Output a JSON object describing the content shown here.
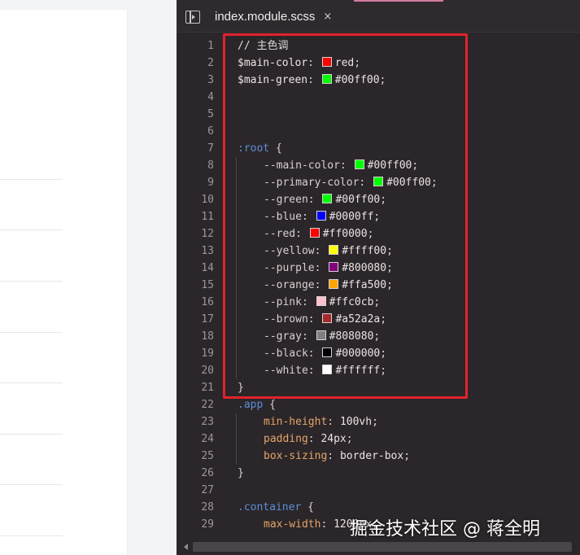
{
  "editor": {
    "tab": {
      "filename": "index.module.scss",
      "close_symbol": "×"
    },
    "colors": {
      "background": "#2b2629",
      "selector": "#5c8fd8",
      "property": "#e4a56a",
      "highlight_box": "#e0232d",
      "tab_accent": "#d57aa3"
    },
    "lines": [
      {
        "num": "1",
        "tokens": [
          {
            "t": "// 主色调",
            "c": "comment"
          }
        ]
      },
      {
        "num": "2",
        "tokens": [
          {
            "t": "$main-color",
            "c": "var"
          },
          {
            "t": ": ",
            "c": "punc"
          },
          {
            "swatch": "#ff0000"
          },
          {
            "t": "red",
            "c": "val"
          },
          {
            "t": ";",
            "c": "punc"
          }
        ]
      },
      {
        "num": "3",
        "tokens": [
          {
            "t": "$main-green",
            "c": "var"
          },
          {
            "t": ": ",
            "c": "punc"
          },
          {
            "swatch": "#00ff00"
          },
          {
            "t": "#00ff00",
            "c": "val"
          },
          {
            "t": ";",
            "c": "punc"
          }
        ]
      },
      {
        "num": "4",
        "tokens": []
      },
      {
        "num": "5",
        "tokens": []
      },
      {
        "num": "6",
        "tokens": []
      },
      {
        "num": "7",
        "tokens": [
          {
            "t": ":root",
            "c": "sel"
          },
          {
            "t": " {",
            "c": "punc"
          }
        ]
      },
      {
        "num": "8",
        "indent": 1,
        "tokens": [
          {
            "t": "--main-color",
            "c": "cprop"
          },
          {
            "t": ": ",
            "c": "punc"
          },
          {
            "swatch": "#00ff00"
          },
          {
            "t": "#00ff00",
            "c": "val"
          },
          {
            "t": ";",
            "c": "punc"
          }
        ]
      },
      {
        "num": "9",
        "indent": 1,
        "tokens": [
          {
            "t": "--primary-color",
            "c": "cprop"
          },
          {
            "t": ": ",
            "c": "punc"
          },
          {
            "swatch": "#00ff00"
          },
          {
            "t": "#00ff00",
            "c": "val"
          },
          {
            "t": ";",
            "c": "punc"
          }
        ]
      },
      {
        "num": "10",
        "indent": 1,
        "tokens": [
          {
            "t": "--green",
            "c": "cprop"
          },
          {
            "t": ": ",
            "c": "punc"
          },
          {
            "swatch": "#00ff00"
          },
          {
            "t": "#00ff00",
            "c": "val"
          },
          {
            "t": ";",
            "c": "punc"
          }
        ]
      },
      {
        "num": "11",
        "indent": 1,
        "tokens": [
          {
            "t": "--blue",
            "c": "cprop"
          },
          {
            "t": ": ",
            "c": "punc"
          },
          {
            "swatch": "#0000ff"
          },
          {
            "t": "#0000ff",
            "c": "val"
          },
          {
            "t": ";",
            "c": "punc"
          }
        ]
      },
      {
        "num": "12",
        "indent": 1,
        "tokens": [
          {
            "t": "--red",
            "c": "cprop"
          },
          {
            "t": ": ",
            "c": "punc"
          },
          {
            "swatch": "#ff0000"
          },
          {
            "t": "#ff0000",
            "c": "val"
          },
          {
            "t": ";",
            "c": "punc"
          }
        ]
      },
      {
        "num": "13",
        "indent": 1,
        "tokens": [
          {
            "t": "--yellow",
            "c": "cprop"
          },
          {
            "t": ": ",
            "c": "punc"
          },
          {
            "swatch": "#ffff00"
          },
          {
            "t": "#ffff00",
            "c": "val"
          },
          {
            "t": ";",
            "c": "punc"
          }
        ]
      },
      {
        "num": "14",
        "indent": 1,
        "tokens": [
          {
            "t": "--purple",
            "c": "cprop"
          },
          {
            "t": ": ",
            "c": "punc"
          },
          {
            "swatch": "#800080"
          },
          {
            "t": "#800080",
            "c": "val"
          },
          {
            "t": ";",
            "c": "punc"
          }
        ]
      },
      {
        "num": "15",
        "indent": 1,
        "tokens": [
          {
            "t": "--orange",
            "c": "cprop"
          },
          {
            "t": ": ",
            "c": "punc"
          },
          {
            "swatch": "#ffa500"
          },
          {
            "t": "#ffa500",
            "c": "val"
          },
          {
            "t": ";",
            "c": "punc"
          }
        ]
      },
      {
        "num": "16",
        "indent": 1,
        "tokens": [
          {
            "t": "--pink",
            "c": "cprop"
          },
          {
            "t": ": ",
            "c": "punc"
          },
          {
            "swatch": "#ffc0cb"
          },
          {
            "t": "#ffc0cb",
            "c": "val"
          },
          {
            "t": ";",
            "c": "punc"
          }
        ]
      },
      {
        "num": "17",
        "indent": 1,
        "tokens": [
          {
            "t": "--brown",
            "c": "cprop"
          },
          {
            "t": ": ",
            "c": "punc"
          },
          {
            "swatch": "#a52a2a"
          },
          {
            "t": "#a52a2a",
            "c": "val"
          },
          {
            "t": ";",
            "c": "punc"
          }
        ]
      },
      {
        "num": "18",
        "indent": 1,
        "tokens": [
          {
            "t": "--gray",
            "c": "cprop"
          },
          {
            "t": ": ",
            "c": "punc"
          },
          {
            "swatch": "#808080"
          },
          {
            "t": "#808080",
            "c": "val"
          },
          {
            "t": ";",
            "c": "punc"
          }
        ]
      },
      {
        "num": "19",
        "indent": 1,
        "tokens": [
          {
            "t": "--black",
            "c": "cprop"
          },
          {
            "t": ": ",
            "c": "punc"
          },
          {
            "swatch": "#000000"
          },
          {
            "t": "#000000",
            "c": "val"
          },
          {
            "t": ";",
            "c": "punc"
          }
        ]
      },
      {
        "num": "20",
        "indent": 1,
        "tokens": [
          {
            "t": "--white",
            "c": "cprop"
          },
          {
            "t": ": ",
            "c": "punc"
          },
          {
            "swatch": "#ffffff"
          },
          {
            "t": "#ffffff",
            "c": "val"
          },
          {
            "t": ";",
            "c": "punc"
          }
        ]
      },
      {
        "num": "21",
        "tokens": [
          {
            "t": "}",
            "c": "punc"
          }
        ]
      },
      {
        "num": "22",
        "tokens": [
          {
            "t": ".app",
            "c": "sel"
          },
          {
            "t": " {",
            "c": "punc"
          }
        ]
      },
      {
        "num": "23",
        "indent": 1,
        "tokens": [
          {
            "t": "min-height",
            "c": "prop"
          },
          {
            "t": ": ",
            "c": "punc"
          },
          {
            "t": "100vh",
            "c": "val"
          },
          {
            "t": ";",
            "c": "punc"
          }
        ]
      },
      {
        "num": "24",
        "indent": 1,
        "tokens": [
          {
            "t": "padding",
            "c": "prop"
          },
          {
            "t": ": ",
            "c": "punc"
          },
          {
            "t": "24px",
            "c": "val"
          },
          {
            "t": ";",
            "c": "punc"
          }
        ]
      },
      {
        "num": "25",
        "indent": 1,
        "tokens": [
          {
            "t": "box-sizing",
            "c": "prop"
          },
          {
            "t": ": ",
            "c": "punc"
          },
          {
            "t": "border-box",
            "c": "val"
          },
          {
            "t": ";",
            "c": "punc"
          }
        ]
      },
      {
        "num": "26",
        "tokens": [
          {
            "t": "}",
            "c": "punc"
          }
        ]
      },
      {
        "num": "27",
        "tokens": []
      },
      {
        "num": "28",
        "tokens": [
          {
            "t": ".container",
            "c": "sel"
          },
          {
            "t": " {",
            "c": "punc"
          }
        ]
      },
      {
        "num": "29",
        "indent": 1,
        "tokens": [
          {
            "t": "max-width",
            "c": "prop"
          },
          {
            "t": ": ",
            "c": "punc"
          },
          {
            "t": "1200px",
            "c": "val"
          },
          {
            "t": ";",
            "c": "punc"
          }
        ]
      }
    ]
  },
  "watermark": {
    "text": "掘金技术社区 @ 蒋全明"
  }
}
